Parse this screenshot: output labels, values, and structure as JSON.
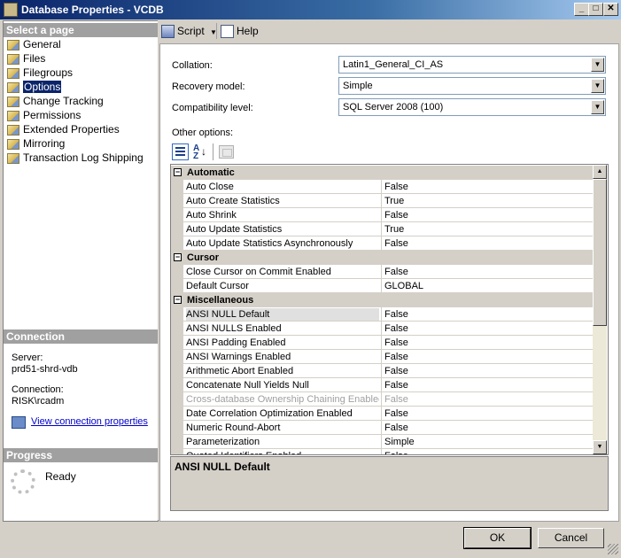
{
  "window": {
    "title": "Database Properties - VCDB"
  },
  "left": {
    "select_page_header": "Select a page",
    "pages": [
      {
        "label": "General"
      },
      {
        "label": "Files"
      },
      {
        "label": "Filegroups"
      },
      {
        "label": "Options",
        "selected": true
      },
      {
        "label": "Change Tracking"
      },
      {
        "label": "Permissions"
      },
      {
        "label": "Extended Properties"
      },
      {
        "label": "Mirroring"
      },
      {
        "label": "Transaction Log Shipping"
      }
    ],
    "connection_header": "Connection",
    "server_label": "Server:",
    "server_value": "prd51-shrd-vdb",
    "connection_label": "Connection:",
    "connection_value": "RISK\\rcadm",
    "view_connection_link": "View connection properties",
    "progress_header": "Progress",
    "progress_status": "Ready"
  },
  "toolbar": {
    "script_label": "Script",
    "help_label": "Help"
  },
  "options": {
    "collation_label": "Collation:",
    "collation_value": "Latin1_General_CI_AS",
    "recovery_label": "Recovery model:",
    "recovery_value": "Simple",
    "compat_label": "Compatibility level:",
    "compat_value": "SQL Server 2008 (100)",
    "other_options_label": "Other options:"
  },
  "grid": {
    "categories": [
      {
        "name": "Automatic",
        "rows": [
          {
            "name": "Auto Close",
            "value": "False"
          },
          {
            "name": "Auto Create Statistics",
            "value": "True"
          },
          {
            "name": "Auto Shrink",
            "value": "False"
          },
          {
            "name": "Auto Update Statistics",
            "value": "True"
          },
          {
            "name": "Auto Update Statistics Asynchronously",
            "value": "False"
          }
        ]
      },
      {
        "name": "Cursor",
        "rows": [
          {
            "name": "Close Cursor on Commit Enabled",
            "value": "False"
          },
          {
            "name": "Default Cursor",
            "value": "GLOBAL"
          }
        ]
      },
      {
        "name": "Miscellaneous",
        "rows": [
          {
            "name": "ANSI NULL Default",
            "value": "False",
            "selected": true
          },
          {
            "name": "ANSI NULLS Enabled",
            "value": "False"
          },
          {
            "name": "ANSI Padding Enabled",
            "value": "False"
          },
          {
            "name": "ANSI Warnings Enabled",
            "value": "False"
          },
          {
            "name": "Arithmetic Abort Enabled",
            "value": "False"
          },
          {
            "name": "Concatenate Null Yields Null",
            "value": "False"
          },
          {
            "name": "Cross-database Ownership Chaining Enabled",
            "value": "False",
            "disabled": true
          },
          {
            "name": "Date Correlation Optimization Enabled",
            "value": "False"
          },
          {
            "name": "Numeric Round-Abort",
            "value": "False"
          },
          {
            "name": "Parameterization",
            "value": "Simple"
          },
          {
            "name": "Quoted Identifiers Enabled",
            "value": "False"
          }
        ]
      }
    ],
    "description_title": "ANSI NULL Default"
  },
  "buttons": {
    "ok": "OK",
    "cancel": "Cancel"
  }
}
